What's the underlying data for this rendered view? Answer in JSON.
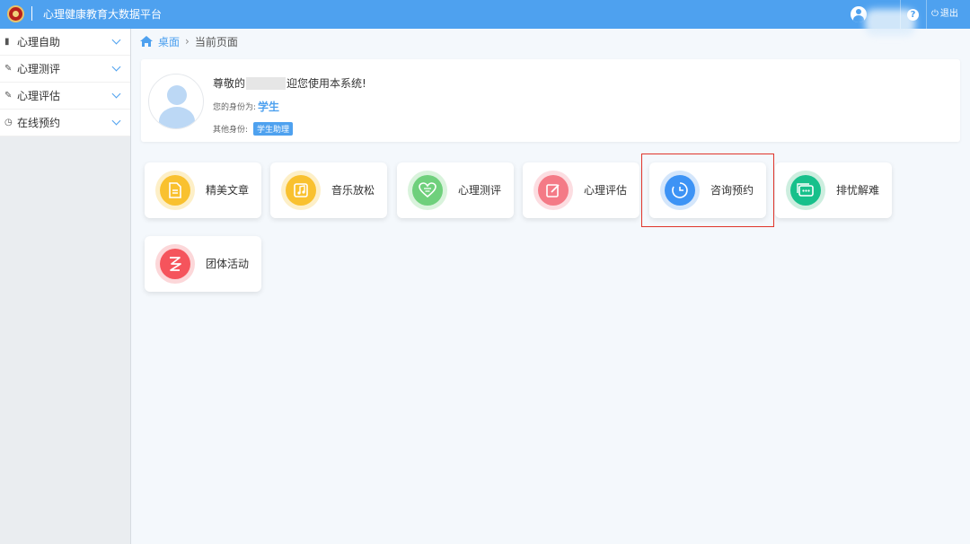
{
  "header": {
    "title": "心理健康教育大数据平台",
    "logout_label": "退出",
    "help_label": "?"
  },
  "sidebar": {
    "items": [
      {
        "label": "心理自助",
        "icon": "book-icon"
      },
      {
        "label": "心理测评",
        "icon": "edit-icon"
      },
      {
        "label": "心理评估",
        "icon": "edit-icon"
      },
      {
        "label": "在线预约",
        "icon": "clock-icon"
      }
    ]
  },
  "breadcrumb": {
    "home": "桌面",
    "current": "当前页面"
  },
  "profile": {
    "greeting_prefix": "尊敬的",
    "greeting_suffix": "迎您使用本系统!",
    "role_label": "您的身份为:",
    "role_value": "学生",
    "other_label": "其他身份:",
    "other_badge": "学生助理"
  },
  "tiles": [
    {
      "label": "精美文章",
      "icon": "document-icon",
      "color": "#f9c12f",
      "ring": "#fdefc7"
    },
    {
      "label": "音乐放松",
      "icon": "music-icon",
      "color": "#f9c12f",
      "ring": "#fdefc7"
    },
    {
      "label": "心理测评",
      "icon": "heart-icon",
      "color": "#6fd07c",
      "ring": "#d9f3dc"
    },
    {
      "label": "心理评估",
      "icon": "pencil-icon",
      "color": "#f47a86",
      "ring": "#fcdde1"
    },
    {
      "label": "咨询预约",
      "icon": "clock-icon",
      "color": "#3d93f5",
      "ring": "#d4e6fb"
    },
    {
      "label": "排忧解难",
      "icon": "chat-icon",
      "color": "#17c08b",
      "ring": "#cdeedf"
    },
    {
      "label": "团体活动",
      "icon": "group-icon",
      "color": "#f5545c",
      "ring": "#fcd7d9"
    }
  ],
  "colors": {
    "header": "#4ea1ef",
    "highlight": "#e0352b"
  }
}
